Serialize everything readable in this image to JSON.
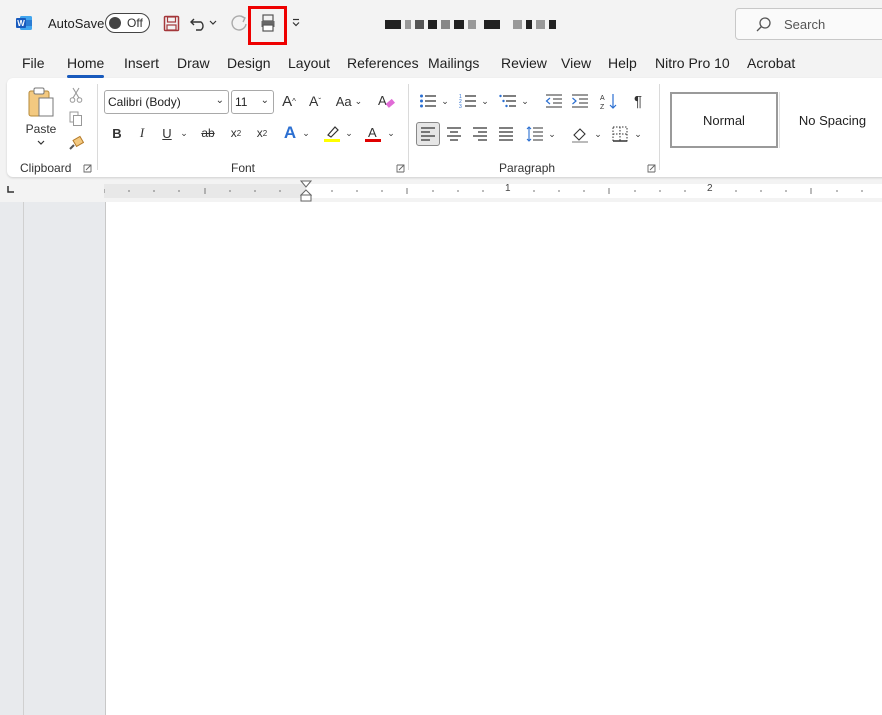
{
  "titlebar": {
    "autosave_label": "AutoSave",
    "autosave_state": "Off",
    "search_placeholder": "Search"
  },
  "tabs": [
    {
      "label": "File"
    },
    {
      "label": "Home"
    },
    {
      "label": "Insert"
    },
    {
      "label": "Draw"
    },
    {
      "label": "Design"
    },
    {
      "label": "Layout"
    },
    {
      "label": "References"
    },
    {
      "label": "Mailings"
    },
    {
      "label": "Review"
    },
    {
      "label": "View"
    },
    {
      "label": "Help"
    },
    {
      "label": "Nitro Pro 10"
    },
    {
      "label": "Acrobat"
    }
  ],
  "ribbon": {
    "clipboard": {
      "paste_label": "Paste",
      "group_label": "Clipboard"
    },
    "font": {
      "font_name": "Calibri (Body)",
      "font_size": "11",
      "group_label": "Font",
      "change_case": "Aa"
    },
    "paragraph": {
      "group_label": "Paragraph"
    },
    "styles": [
      {
        "label": "Normal"
      },
      {
        "label": "No Spacing"
      }
    ]
  },
  "ruler": {
    "marks": [
      "1",
      "2"
    ]
  },
  "colors": {
    "accent": "#185abd",
    "highlight_box": "#e00000",
    "text_highlight": "#ffff00",
    "font_color": "#e00000"
  }
}
